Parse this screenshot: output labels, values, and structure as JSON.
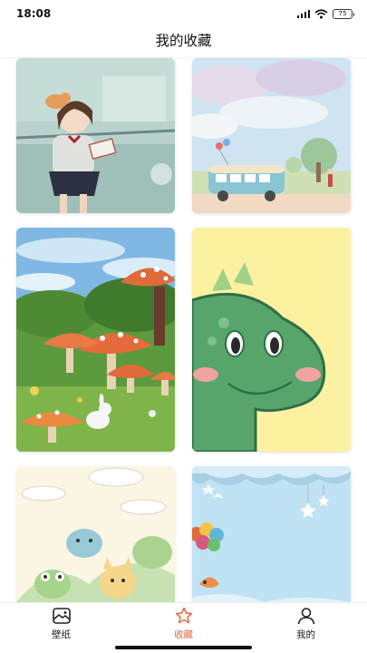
{
  "status_bar": {
    "time": "18:08",
    "battery": "75"
  },
  "header": {
    "title": "我的收藏"
  },
  "wallpapers": [
    {
      "name": "girl-reading-with-cat"
    },
    {
      "name": "bus-in-meadow"
    },
    {
      "name": "mushroom-forest"
    },
    {
      "name": "green-dinosaur"
    },
    {
      "name": "cute-animals-clouds"
    },
    {
      "name": "paper-sky-balloons"
    }
  ],
  "tabs": [
    {
      "label": "壁纸",
      "icon": "wallpaper-icon",
      "active": false
    },
    {
      "label": "收藏",
      "icon": "star-icon",
      "active": true
    },
    {
      "label": "我的",
      "icon": "person-icon",
      "active": false
    }
  ],
  "colors": {
    "accent": "#e8643c",
    "text": "#222222"
  }
}
